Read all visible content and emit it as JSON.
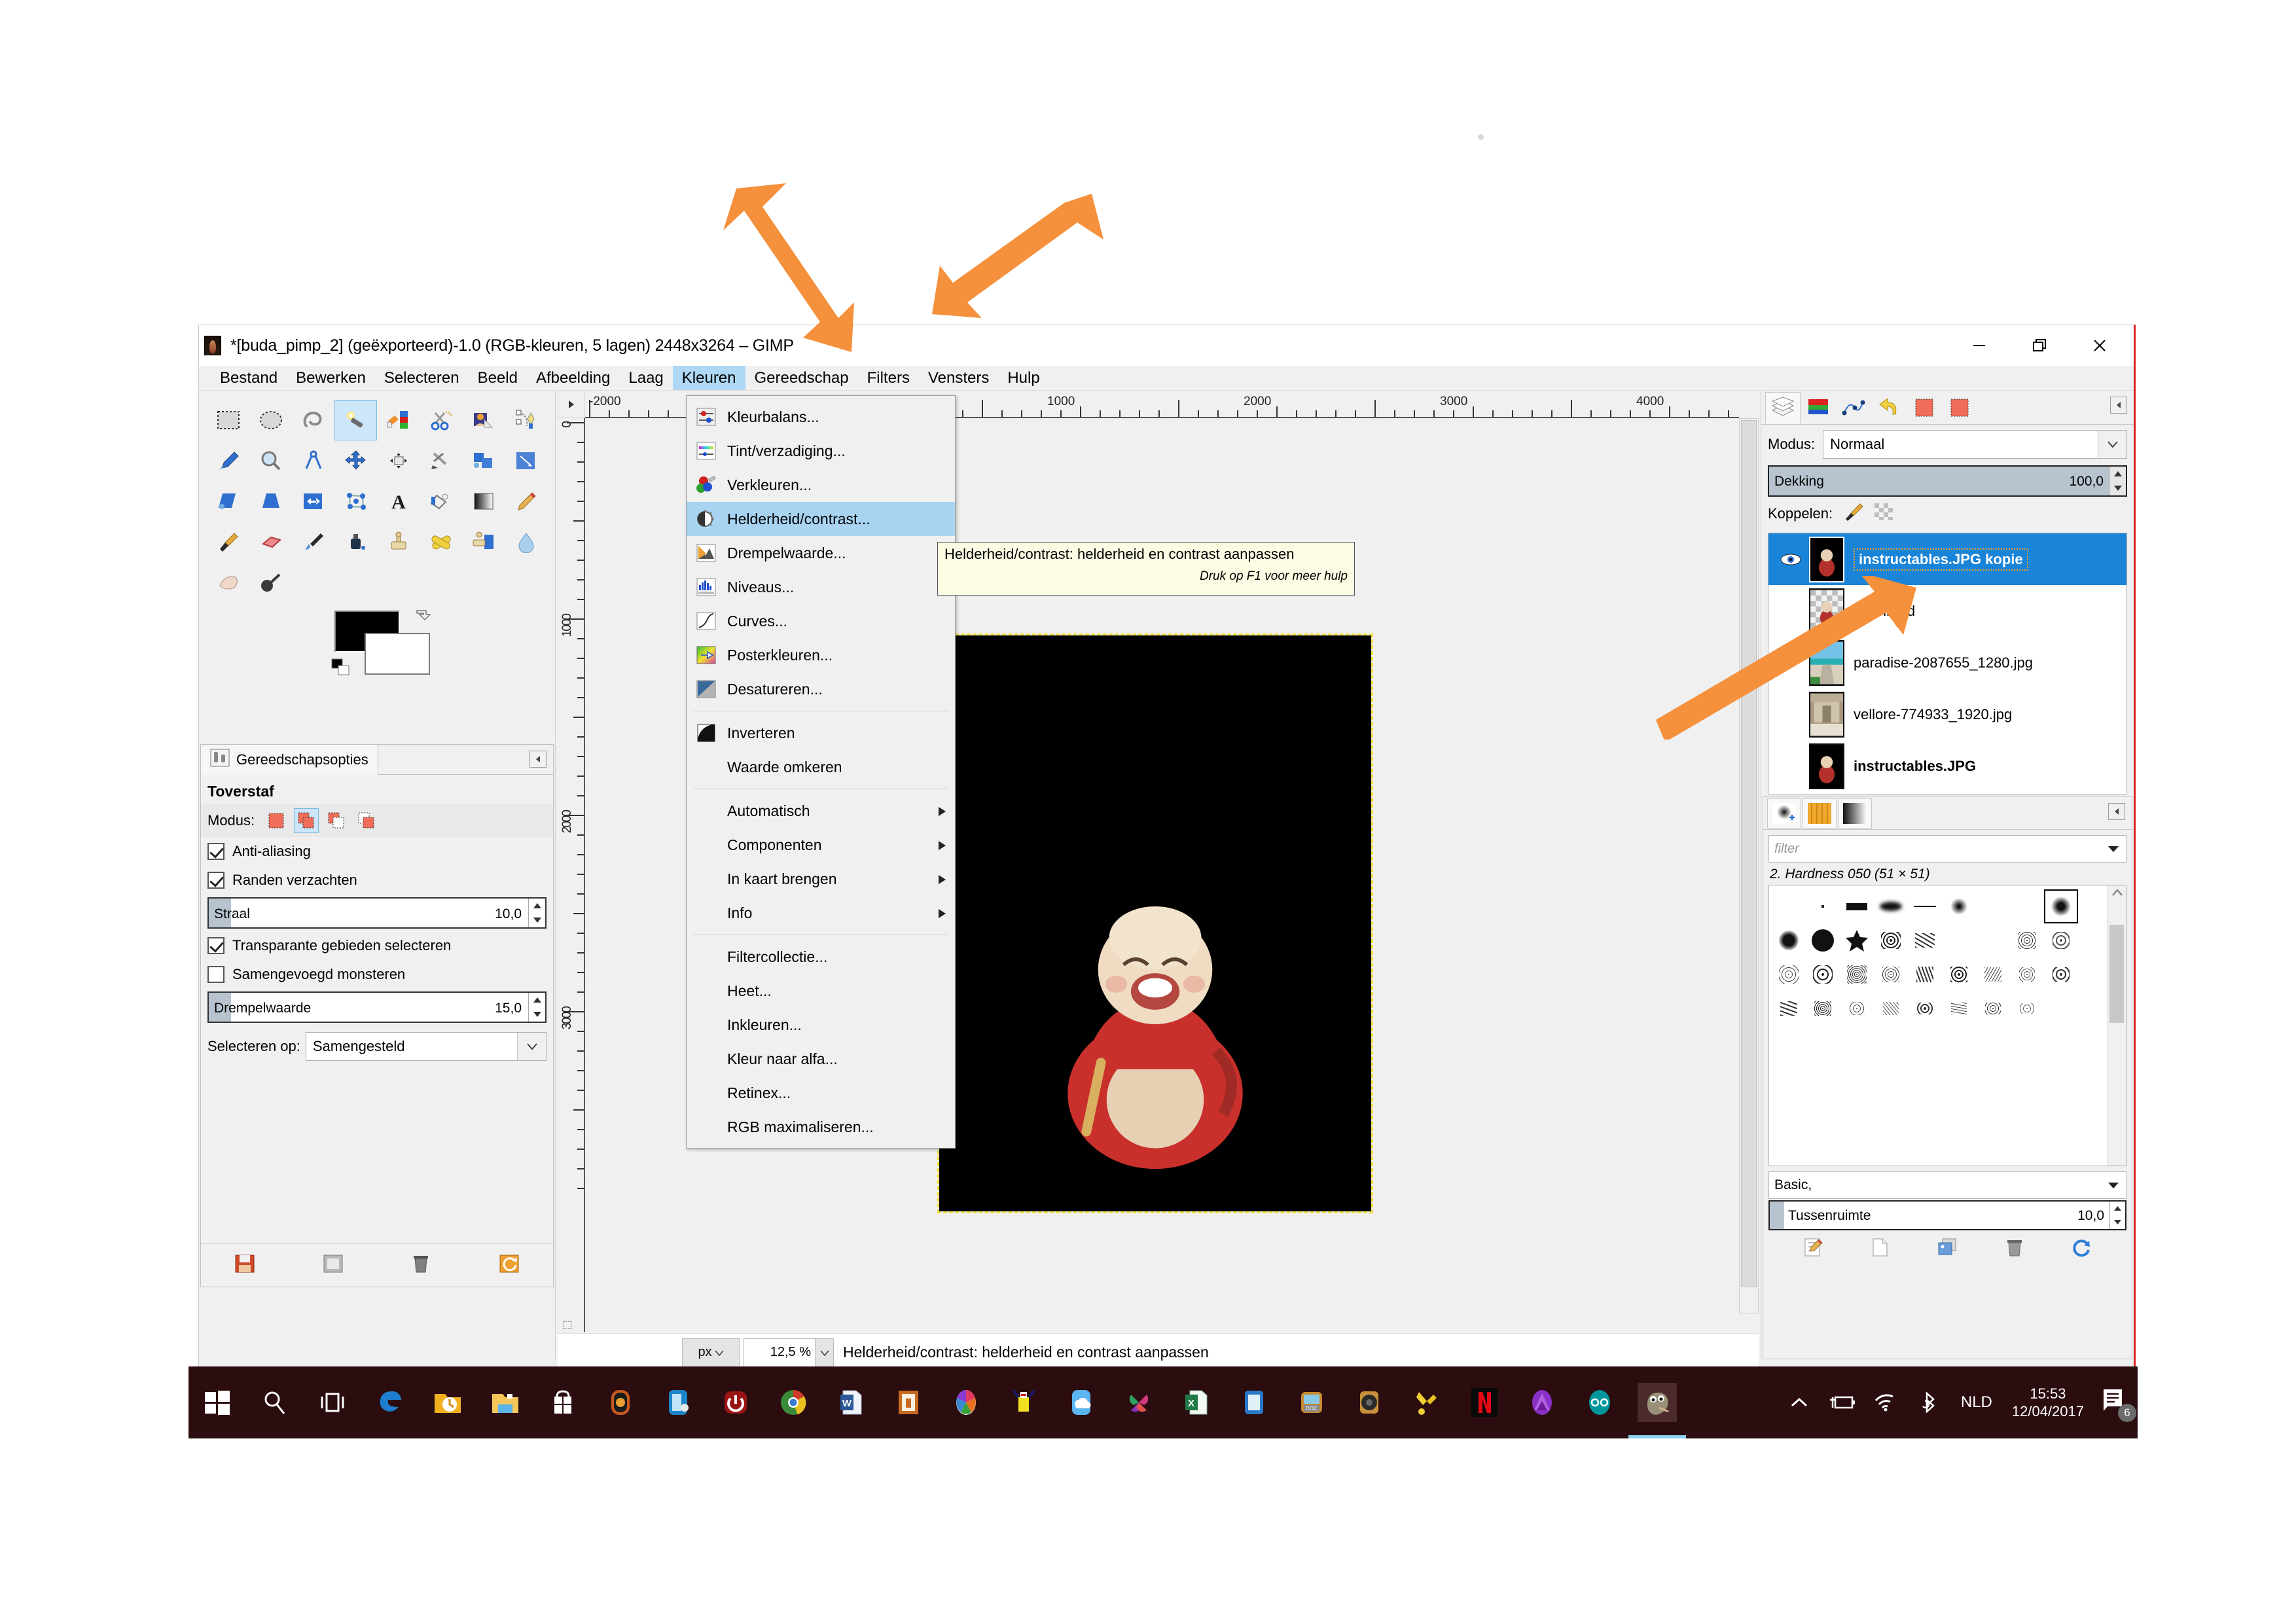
{
  "window": {
    "title": "*[buda_pimp_2] (geëxporteerd)-1.0 (RGB-kleuren, 5 lagen) 2448x3264 – GIMP",
    "controls": {
      "minimize": "minimize-icon",
      "restore": "restore-icon",
      "close": "close-icon"
    }
  },
  "menubar": {
    "items": [
      {
        "label": "Bestand",
        "mnemonic": "B"
      },
      {
        "label": "Bewerken",
        "mnemonic": "w"
      },
      {
        "label": "Selecteren",
        "mnemonic": "S"
      },
      {
        "label": "Beeld",
        "mnemonic": "d"
      },
      {
        "label": "Afbeelding",
        "mnemonic": "A"
      },
      {
        "label": "Laag",
        "mnemonic": "L"
      },
      {
        "label": "Kleuren",
        "mnemonic": "K"
      },
      {
        "label": "Gereedschap",
        "mnemonic": "G"
      },
      {
        "label": "Filters",
        "mnemonic": "F"
      },
      {
        "label": "Vensters",
        "mnemonic": "V"
      },
      {
        "label": "Hulp",
        "mnemonic": "H"
      }
    ],
    "active": "Kleuren"
  },
  "kleuren_menu": {
    "items": [
      {
        "label": "Kleurbalans...",
        "icon": "color-balance-icon",
        "mnemonic": "K"
      },
      {
        "label": "Tint/verzadiging...",
        "icon": "hue-saturation-icon",
        "mnemonic": "v"
      },
      {
        "label": "Verkleuren...",
        "icon": "colorize-icon",
        "mnemonic": "V"
      },
      {
        "label": "Helderheid/contrast...",
        "icon": "brightness-contrast-icon",
        "mnemonic": "H",
        "highlighted": true
      },
      {
        "label": "Drempelwaarde...",
        "icon": "threshold-icon",
        "mnemonic": "D"
      },
      {
        "label": "Niveaus...",
        "icon": "levels-icon",
        "mnemonic": "N"
      },
      {
        "label": "Curves...",
        "icon": "curves-icon",
        "mnemonic": "C"
      },
      {
        "label": "Posterkleuren...",
        "icon": "posterize-icon",
        "mnemonic": "P"
      },
      {
        "label": "Desatureren...",
        "icon": "desaturate-icon",
        "mnemonic": "D"
      },
      {
        "separator": true
      },
      {
        "label": "Inverteren",
        "icon": "invert-icon",
        "mnemonic": "v"
      },
      {
        "label": "Waarde omkeren",
        "icon": "",
        "mnemonic": "W"
      },
      {
        "separator": true
      },
      {
        "label": "Automatisch",
        "icon": "",
        "mnemonic": "A",
        "submenu": true
      },
      {
        "label": "Componenten",
        "icon": "",
        "mnemonic": "C",
        "submenu": true
      },
      {
        "label": "In kaart brengen",
        "icon": "",
        "mnemonic": "k",
        "submenu": true
      },
      {
        "label": "Info",
        "icon": "",
        "mnemonic": "n",
        "submenu": true
      },
      {
        "separator": true
      },
      {
        "label": "Filtercollectie...",
        "icon": "",
        "mnemonic": "F"
      },
      {
        "label": "Heet...",
        "icon": "",
        "mnemonic": "H"
      },
      {
        "label": "Inkleuren...",
        "icon": "",
        "mnemonic": "I"
      },
      {
        "label": "Kleur naar alfa...",
        "icon": "",
        "mnemonic": "a"
      },
      {
        "label": "Retinex...",
        "icon": "",
        "mnemonic": "x"
      },
      {
        "label": "RGB maximaliseren...",
        "icon": "",
        "mnemonic": "R"
      }
    ]
  },
  "tooltip": {
    "line1": "Helderheid/contrast: helderheid en contrast aanpassen",
    "line2": "Druk op F1 voor meer hulp"
  },
  "toolbox": {
    "tools": [
      "rect-select-icon",
      "ellipse-select-icon",
      "free-select-icon",
      "fuzzy-select-icon",
      "select-by-color-icon",
      "scissors-select-icon",
      "foreground-select-icon",
      "paths-icon",
      "color-picker-icon",
      "zoom-icon",
      "measure-icon",
      "move-icon",
      "align-icon",
      "crop-icon",
      "rotate-icon",
      "scale-icon",
      "shear-icon",
      "perspective-icon",
      "flip-icon",
      "cage-transform-icon",
      "text-icon",
      "bucket-fill-icon",
      "gradient-icon",
      "pencil-icon",
      "paintbrush-icon",
      "eraser-icon",
      "airbrush-icon",
      "ink-icon",
      "clone-icon",
      "heal-icon",
      "perspective-clone-icon",
      "blur-sharpen-icon",
      "smudge-icon",
      "dodge-burn-icon"
    ],
    "selected_index": 3,
    "foreground_color": "#000000",
    "background_color": "#ffffff"
  },
  "tool_options": {
    "tab_label": "Gereedschapsopties",
    "tab_icon": "tool-options-icon",
    "collapse_icon": "collapse-left-icon",
    "tool_name": "Toverstaf",
    "mode_label": "Modus:",
    "modes": [
      "replace-selection-icon",
      "add-to-selection-icon",
      "subtract-from-selection-icon",
      "intersect-with-selection-icon"
    ],
    "mode_selected_index": 1,
    "antialias": {
      "label": "Anti-aliasing",
      "checked": true
    },
    "feather": {
      "label": "Randen verzachten",
      "checked": true
    },
    "radius": {
      "label": "Straal",
      "value": "10,0"
    },
    "select_transparent": {
      "label": "Transparante gebieden selecteren",
      "checked": true
    },
    "sample_merged": {
      "label": "Samengevoegd monsteren",
      "checked": false
    },
    "threshold": {
      "label": "Drempelwaarde",
      "value": "15,0"
    },
    "select_by": {
      "label": "Selecteren op:",
      "value": "Samengesteld"
    },
    "footer_icons": [
      "save-tool-preset-icon",
      "restore-tool-preset-icon",
      "delete-tool-preset-icon",
      "reset-tool-options-icon"
    ]
  },
  "canvas": {
    "h_ruler_labels": [
      "-2000",
      "1000",
      "2000",
      "3000",
      "4000"
    ],
    "v_ruler_labels": [
      "0",
      "1000",
      "2000",
      "3000"
    ],
    "image_alt": "buddha-figurine-on-black-background"
  },
  "statusbar": {
    "unit": "px",
    "zoom": "12,5 %",
    "message": "Helderheid/contrast: helderheid en contrast aanpassen"
  },
  "layers_dock": {
    "tabs": [
      "layers-tab-icon",
      "channels-tab-icon",
      "paths-tab-icon",
      "undo-history-tab-icon",
      "selection-editor-tab-icon",
      "pointer-tab-icon"
    ],
    "active_tab_index": 0,
    "collapse_icon": "collapse-left-icon",
    "mode_label": "Modus:",
    "mode_value": "Normaal",
    "opacity_label": "Dekking",
    "opacity_value": "100,0",
    "lock_label": "Koppelen:",
    "lock_icons": [
      "lock-pixels-icon",
      "lock-alpha-icon"
    ],
    "layers": [
      {
        "name": "instructables.JPG kopie",
        "visible": true,
        "selected": true,
        "thumb": "photo",
        "bold": true
      },
      {
        "name": "Klembord",
        "visible": false,
        "selected": false,
        "thumb": "checker",
        "bold": false
      },
      {
        "name": "paradise-2087655_1280.jpg",
        "visible": false,
        "selected": false,
        "thumb": "paradise",
        "bold": false
      },
      {
        "name": "vellore-774933_1920.jpg",
        "visible": false,
        "selected": false,
        "thumb": "vellore",
        "bold": false
      },
      {
        "name": "instructables.JPG",
        "visible": false,
        "selected": false,
        "thumb": "photo",
        "bold": true
      }
    ],
    "footer_icons": [
      "new-layer-icon",
      "new-layer-group-icon",
      "raise-layer-icon",
      "lower-layer-icon",
      "duplicate-layer-icon",
      "anchor-layer-icon",
      "delete-layer-icon"
    ]
  },
  "brushes_dock": {
    "tabs": [
      "brushes-tab-icon",
      "patterns-tab-icon",
      "gradients-tab-icon"
    ],
    "active_tab_index": 0,
    "collapse_icon": "collapse-left-icon",
    "filter_placeholder": "filter",
    "brush_name": "2. Hardness 050 (51 × 51)",
    "tag_value": "Basic,",
    "spacing_label": "Tussenruimte",
    "spacing_value": "10,0",
    "footer_icons": [
      "edit-brush-icon",
      "new-brush-icon",
      "duplicate-brush-icon",
      "delete-brush-icon",
      "refresh-brushes-icon"
    ]
  },
  "taskbar": {
    "start_icon": "windows-start-icon",
    "icons": [
      "search-icon",
      "task-view-icon",
      "edge-icon",
      "outlook-folder-icon",
      "file-explorer-icon",
      "microsoft-store-icon",
      "photo-viewer-icon",
      "device-app-icon",
      "shutdown-icon",
      "google-chrome-icon",
      "word-icon",
      "app-orange-icon",
      "picasa-icon",
      "lego-icon",
      "onedrive-icon",
      "pinwheel-icon",
      "excel-icon",
      "app-blue-icon",
      "doc-scanner-icon",
      "speaker-icon",
      "yellow-tool-icon",
      "netflix-icon",
      "affinity-photo-icon",
      "arduino-icon",
      "gimp-icon"
    ],
    "active_icon": "gimp-icon",
    "tray": {
      "show_hidden_icon": "chevron-up-icon",
      "battery_icon": "battery-charging-icon",
      "wifi_icon": "wifi-icon",
      "bluetooth_icon": "bluetooth-icon",
      "language": "NLD",
      "time": "15:53",
      "date": "12/04/2017",
      "notification_icon": "action-center-icon",
      "notification_count": "6"
    }
  },
  "annotations": {
    "arrow_color": "#f5903c",
    "arrows": [
      {
        "name": "arrow-to-kleuren-menu"
      },
      {
        "name": "arrow-to-helderheid-contrast"
      },
      {
        "name": "arrow-to-layer-thumbnail"
      }
    ]
  }
}
